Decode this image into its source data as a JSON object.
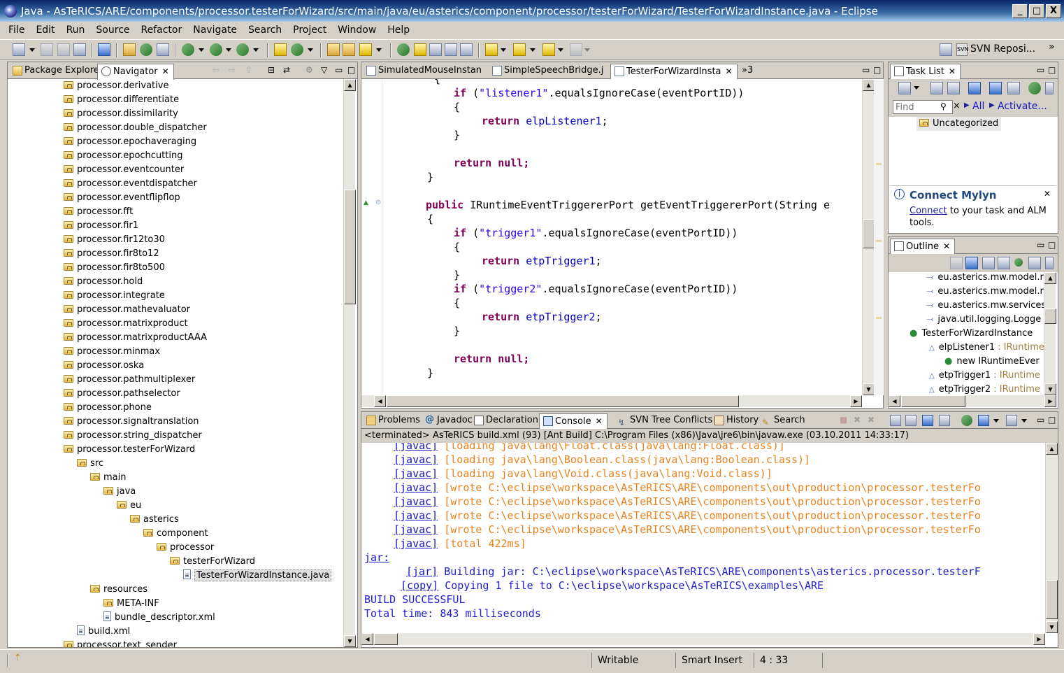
{
  "window": {
    "title": "Java - AsTeRICS/ARE/components/processor.testerForWizard/src/main/java/eu/asterics/component/processor/testerForWizard/TesterForWizardInstance.java - Eclipse",
    "btn_min": "_",
    "btn_max": "□",
    "btn_close": "X"
  },
  "menu": [
    "File",
    "Edit",
    "Run",
    "Source",
    "Refactor",
    "Navigate",
    "Search",
    "Project",
    "Window",
    "Help"
  ],
  "toolbar": {
    "svn_label": "SVN Reposi...",
    "overflow": "»"
  },
  "left": {
    "tabs": [
      "Package Explorer",
      "Navigator"
    ],
    "items": [
      "processor.derivative",
      "processor.differentiate",
      "processor.dissimilarity",
      "processor.double_dispatcher",
      "processor.epochaveraging",
      "processor.epochcutting",
      "processor.eventcounter",
      "processor.eventdispatcher",
      "processor.eventflipflop",
      "processor.fft",
      "processor.fir1",
      "processor.fir12to30",
      "processor.fir8to12",
      "processor.fir8to500",
      "processor.hold",
      "processor.integrate",
      "processor.mathevaluator",
      "processor.matrixproduct",
      "processor.matrixproductAAA",
      "processor.minmax",
      "processor.oska",
      "processor.pathmultiplexer",
      "processor.pathselector",
      "processor.phone",
      "processor.signaltranslation",
      "processor.string_dispatcher",
      "processor.testerForWizard",
      "src",
      "main",
      "java",
      "eu",
      "asterics",
      "component",
      "processor",
      "testerForWizard",
      "TesterForWizardInstance.java",
      "resources",
      "META-INF",
      "bundle_descriptor.xml",
      "build.xml",
      "processor.text_sender"
    ]
  },
  "editor": {
    "tabs": [
      "SimulatedMouseInstan",
      "SimpleSpeechBridge.j",
      "TesterForWizardInsta"
    ],
    "more": "»3"
  },
  "code": {
    "lbrace": "{",
    "rbrace": "}",
    "if": "if",
    "return": "return",
    "null": "null;",
    "public": "public",
    "s_listener1": "\"listener1\"",
    "s_trigger1": "\"trigger1\"",
    "s_trigger2": "\"trigger2\"",
    "eq_call": ".equalsIgnoreCase(eventPortID))",
    "elp": "elpListener1",
    "etp1": "etpTrigger1",
    "etp2": "etpTrigger2",
    "semi": ";",
    "method_sig": " IRuntimeEventTriggererPort getEventTriggererPort(String e",
    "open_paren": "("
  },
  "tasklist": {
    "tab": "Task List",
    "find_placeholder": "Find",
    "all": "All",
    "activate": "Activate...",
    "uncategorized": "Uncategorized"
  },
  "mylyn": {
    "title": "Connect Mylyn",
    "link": "Connect",
    "text1": " to your task and ALM",
    "text2": "tools."
  },
  "outline": {
    "tab": "Outline",
    "items": [
      "eu.asterics.mw.model.r",
      "eu.asterics.mw.model.r",
      "eu.asterics.mw.services",
      "java.util.logging.Logge",
      "TesterForWizardInstance",
      "elpListener1",
      "new IRuntimeEver",
      "etpTrigger1",
      "etpTrigger2"
    ],
    "type_suffix": " : IRuntime"
  },
  "bottom": {
    "tabs": [
      "Problems",
      "Javadoc",
      "Declaration",
      "Console",
      "SVN Tree Conflicts",
      "History",
      "Search"
    ],
    "header": "<terminated> AsTeRICS build.xml (93) [Ant Build] C:\\Program Files (x86)\\Java\\jre6\\bin\\javaw.exe (03.10.2011 14:33:17)"
  },
  "console": {
    "javac": "[javac]",
    "jar_tag": "[jar]",
    "copy_tag": "[copy]",
    "jar_label": "jar:",
    "lines": [
      "[loading java\\lang\\Float.class(java\\lang:Float.class)]",
      "[loading java\\lang\\Boolean.class(java\\lang:Boolean.class)]",
      "[loading java\\lang\\Void.class(java\\lang:Void.class)]",
      "[wrote C:\\eclipse\\workspace\\AsTeRICS\\ARE\\components\\out\\production\\processor.testerFo",
      "[wrote C:\\eclipse\\workspace\\AsTeRICS\\ARE\\components\\out\\production\\processor.testerFo",
      "[wrote C:\\eclipse\\workspace\\AsTeRICS\\ARE\\components\\out\\production\\processor.testerFo",
      "[wrote C:\\eclipse\\workspace\\AsTeRICS\\ARE\\components\\out\\production\\processor.testerFo",
      "[total 422ms]"
    ],
    "jar_line": "Building jar: C:\\eclipse\\workspace\\AsTeRICS\\ARE\\components\\asterics.processor.testerF",
    "copy_line": "Copying 1 file to C:\\eclipse\\workspace\\AsTeRICS\\examples\\ARE",
    "build": "BUILD SUCCESSFUL",
    "total": "Total time: 843 milliseconds"
  },
  "status": {
    "writable": "Writable",
    "insert": "Smart Insert",
    "position": "4 : 33"
  }
}
